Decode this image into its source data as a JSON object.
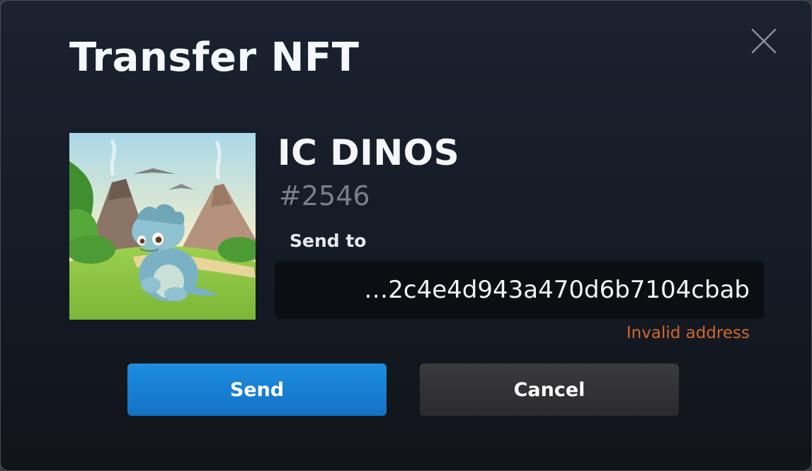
{
  "modal": {
    "title": "Transfer NFT",
    "close_icon": "close-icon"
  },
  "nft": {
    "collection": "IC DINOS",
    "token_id": "#2546",
    "image": "dino-image"
  },
  "form": {
    "send_to_label": "Send to",
    "address_value": "…2c4e4d943a470d6b7104cbab",
    "error_text": "Invalid address"
  },
  "buttons": {
    "send_label": "Send",
    "cancel_label": "Cancel"
  },
  "colors": {
    "accent": "#1a82d6",
    "error": "#d0682a",
    "background": "#151b25",
    "input_bg": "#0b0e13"
  }
}
